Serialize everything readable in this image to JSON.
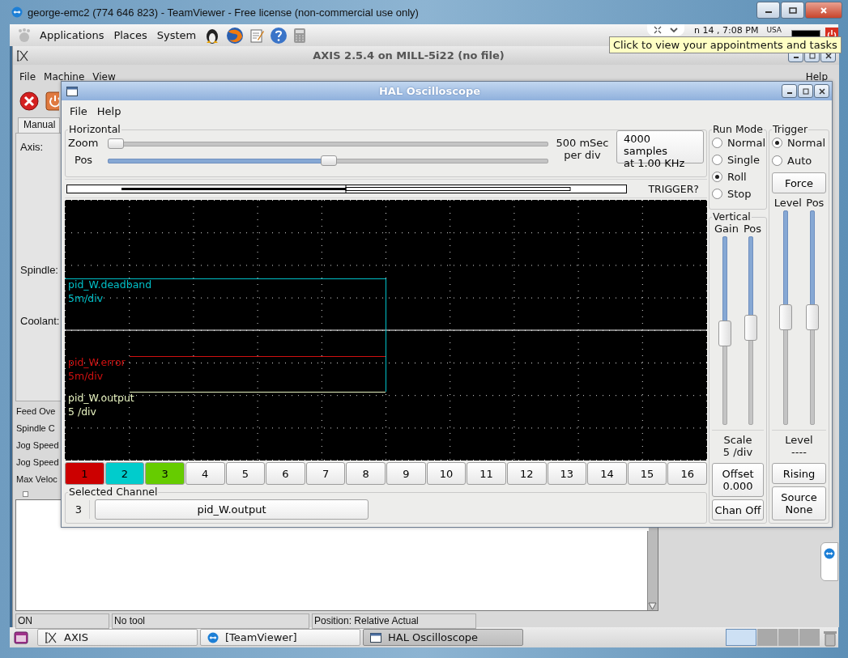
{
  "teamviewer": {
    "title": "george-emc2 (774 646 823) - TeamViewer - Free license (non-commercial use only)"
  },
  "top_panel": {
    "menus": [
      "Applications",
      "Places",
      "System"
    ],
    "clock": "n 14 , 7:08 PM",
    "keyboard_layout": "USA"
  },
  "tooltip": "Click to view your appointments and tasks",
  "axis": {
    "title": "AXIS 2.5.4 on MILL-5i22 (no file)",
    "menus": [
      "File",
      "Machine",
      "View"
    ],
    "help_menu": "Help",
    "tab": "Manual",
    "labels": [
      "Axis:",
      "Spindle:",
      "Coolant:"
    ],
    "override_labels": [
      "Feed Ove",
      "Spindle C",
      "Jog Speed",
      "Jog Speed",
      "Max Veloc"
    ],
    "status_bar": [
      "ON",
      "No tool",
      "Position: Relative Actual"
    ]
  },
  "scope": {
    "title": "HAL Oscilloscope",
    "menus": [
      "File",
      "Help"
    ],
    "horizontal": {
      "title": "Horizontal",
      "sliders": [
        {
          "label": "Zoom",
          "level": 0.0
        },
        {
          "label": "Pos",
          "level": 0.5
        }
      ],
      "rate": "500 mSec\nper div",
      "samples": "4000 samples\nat 1.00 KHz"
    },
    "trigger_status": "TRIGGER?",
    "traces": [
      {
        "name": "pid_W.deadband",
        "scale": "5m/div",
        "color": "#00c0c8"
      },
      {
        "name": "pid_W.error",
        "scale": "5m/div",
        "color": "#d01010"
      },
      {
        "name": "pid_W.output",
        "scale": "5 /div",
        "color": "#e8f4c0"
      }
    ],
    "channels": [
      {
        "label": "1",
        "color": "#cc0000"
      },
      {
        "label": "2",
        "color": "#00cccc"
      },
      {
        "label": "3",
        "color": "#66cc00"
      },
      {
        "label": "4"
      },
      {
        "label": "5"
      },
      {
        "label": "6"
      },
      {
        "label": "7"
      },
      {
        "label": "8"
      },
      {
        "label": "9"
      },
      {
        "label": "10"
      },
      {
        "label": "11"
      },
      {
        "label": "12"
      },
      {
        "label": "13"
      },
      {
        "label": "14"
      },
      {
        "label": "15"
      },
      {
        "label": "16"
      }
    ],
    "selected_channel": {
      "title": "Selected Channel",
      "number": "3",
      "name": "pid_W.output"
    },
    "run_mode": {
      "title": "Run Mode",
      "options": [
        {
          "label": "Normal",
          "selected": false
        },
        {
          "label": "Single",
          "selected": false
        },
        {
          "label": "Roll",
          "selected": true
        },
        {
          "label": "Stop",
          "selected": false
        }
      ]
    },
    "vertical": {
      "title": "Vertical",
      "sliders": [
        {
          "label": "Gain",
          "level": 0.48
        },
        {
          "label": "Pos",
          "level": 0.51
        }
      ],
      "scale": "Scale\n5 /div",
      "offset": "Offset\n0.000",
      "chan_off": "Chan Off"
    },
    "trigger": {
      "title": "Trigger",
      "options": [
        {
          "label": "Normal",
          "selected": true
        },
        {
          "label": "Auto",
          "selected": false
        }
      ],
      "force": "Force",
      "sliders": [
        {
          "label": "Level",
          "level": 0.5
        },
        {
          "label": "Pos",
          "level": 0.5
        }
      ],
      "level_caption": "Level\n----",
      "edge": "Rising",
      "source": "Source\nNone"
    }
  },
  "taskbar": [
    {
      "label": "AXIS",
      "selected": false
    },
    {
      "label": "[TeamViewer]",
      "selected": false
    },
    {
      "label": "HAL Oscilloscope",
      "selected": true
    }
  ]
}
